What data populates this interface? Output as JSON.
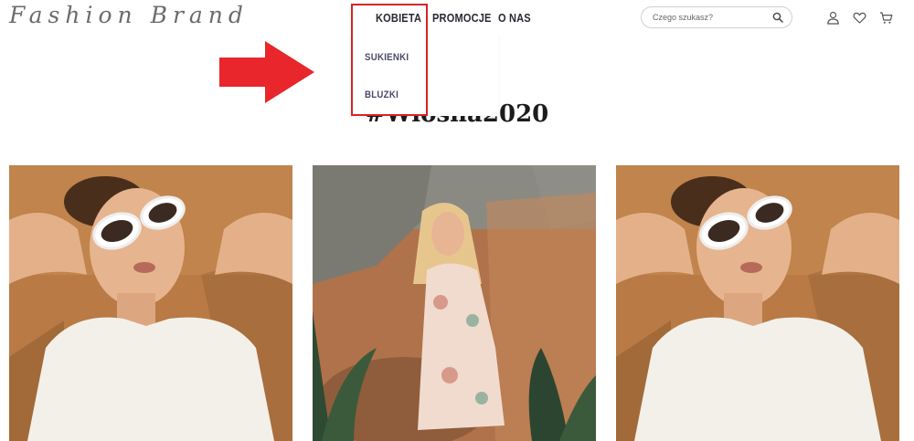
{
  "header": {
    "logo_text": "Fashion Brand",
    "nav": {
      "kobieta": "KOBIETA",
      "promocje": "PROMOCJE",
      "onas": "O NAS"
    },
    "search": {
      "placeholder": "Czego szukasz?",
      "value": ""
    },
    "icons": [
      "search-icon",
      "user-icon",
      "heart-icon",
      "cart-icon"
    ]
  },
  "dropdown": {
    "items": [
      "SUKIENKI",
      "BLUZKI"
    ]
  },
  "main": {
    "title": "#Wiosna2020"
  },
  "annotations": {
    "highlight_color": "#d42525",
    "arrow_color": "#e8262b"
  },
  "colors": {
    "nav_text": "#2a2a35",
    "dropdown_text": "#4a4a6a",
    "photo_wall": "#b97a45"
  }
}
